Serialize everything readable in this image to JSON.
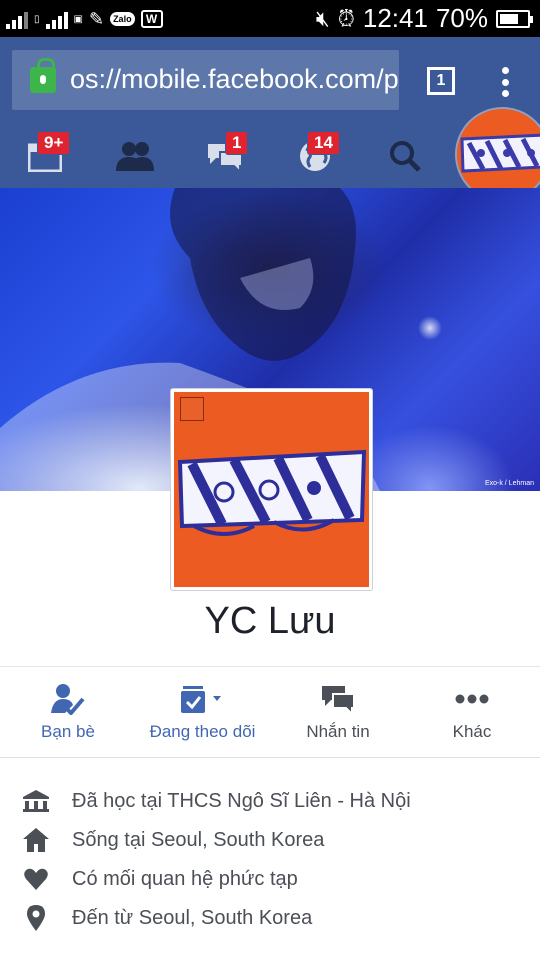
{
  "status_bar": {
    "time": "12:41",
    "battery_percent": "70%",
    "battery_level": 0.7,
    "app_icons": [
      "signal-icon",
      "sim-icon",
      "zalo-icon",
      "w-app-icon"
    ],
    "zalo_label": "Zalo",
    "w_label": "W"
  },
  "browser": {
    "url": "os://mobile.facebook.com/p",
    "tab_count": "1"
  },
  "fb_nav": {
    "items": [
      {
        "icon": "feed-icon",
        "badge": "9+"
      },
      {
        "icon": "friend-requests-icon",
        "badge": ""
      },
      {
        "icon": "messages-icon",
        "badge": "1"
      },
      {
        "icon": "notifications-globe-icon",
        "badge": "14"
      },
      {
        "icon": "search-icon",
        "badge": ""
      }
    ],
    "badge_color": "#e0242f",
    "nav_color": "#3b5998"
  },
  "profile": {
    "name": "YC Lưu",
    "cover_credit": "Exo-k / Lehman"
  },
  "actions": [
    {
      "label": "Bạn bè",
      "icon": "friends-check-icon",
      "color": "#4267b2"
    },
    {
      "label": "Đang theo dõi",
      "icon": "following-icon",
      "color": "#4267b2"
    },
    {
      "label": "Nhắn tin",
      "icon": "message-icon",
      "color": "#4b4f56"
    },
    {
      "label": "Khác",
      "icon": "more-icon",
      "color": "#4b4f56"
    }
  ],
  "info": [
    {
      "icon": "school-icon",
      "text": "Đã học tại THCS Ngô Sĩ Liên - Hà Nội"
    },
    {
      "icon": "home-icon",
      "text": "Sống tại Seoul, South Korea"
    },
    {
      "icon": "heart-icon",
      "text": "Có mối quan hệ phức tạp"
    },
    {
      "icon": "location-pin-icon",
      "text": "Đến từ Seoul, South Korea"
    }
  ]
}
